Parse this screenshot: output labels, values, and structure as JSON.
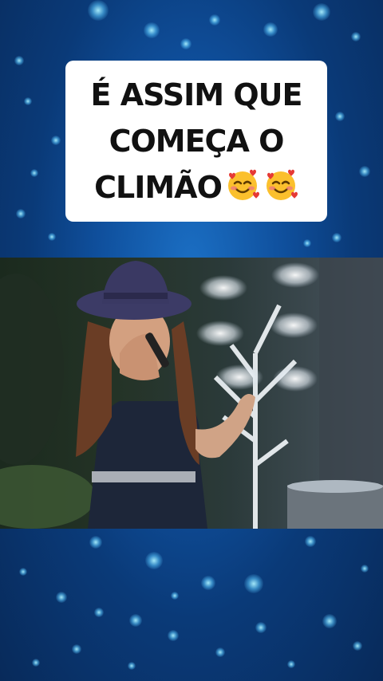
{
  "caption": {
    "line1": "É ASSIM QUE",
    "line2": "COMEÇA O",
    "line3": "CLIMÃO",
    "emoji_icon": "smiling-face-with-hearts-icon"
  },
  "video": {
    "scene": "performer-video-frame"
  },
  "colors": {
    "background": "#0f4f9c",
    "card": "#ffffff",
    "caption_text": "#111111"
  }
}
